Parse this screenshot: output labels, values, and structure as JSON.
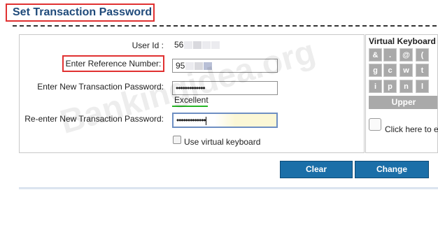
{
  "page": {
    "title": "Set Transaction Password"
  },
  "form": {
    "user_id_label": "User Id :",
    "user_id_value": "56",
    "reference_label": "Enter Reference Number:",
    "reference_value": "95",
    "new_password_label": "Enter New Transaction Password:",
    "new_password_value": "•••••••••••••",
    "strength_text": "Excellent",
    "reenter_password_label": "Re-enter New Transaction Password:",
    "reenter_password_value": "•••••••••••••",
    "virtual_keyboard_checkbox_label": "Use virtual keyboard",
    "virtual_keyboard_checked": false
  },
  "virtual_keyboard": {
    "title": "Virtual Keyboard :",
    "row1": [
      "&",
      ".",
      "@",
      "("
    ],
    "row2": [
      "g",
      "c",
      "w",
      "t"
    ],
    "row3": [
      "i",
      "p",
      "n",
      "l"
    ],
    "upper_label": "Upper",
    "click_label": "Click here to e"
  },
  "buttons": {
    "clear": "Clear",
    "change": "Change"
  },
  "watermark": "Bankingidea.org",
  "colors": {
    "title": "#1f4a7a",
    "highlight_border": "#e03131",
    "button_bg": "#1b6fa8",
    "strength_bar": "#25b525",
    "key_bg": "#a9a9a9"
  }
}
